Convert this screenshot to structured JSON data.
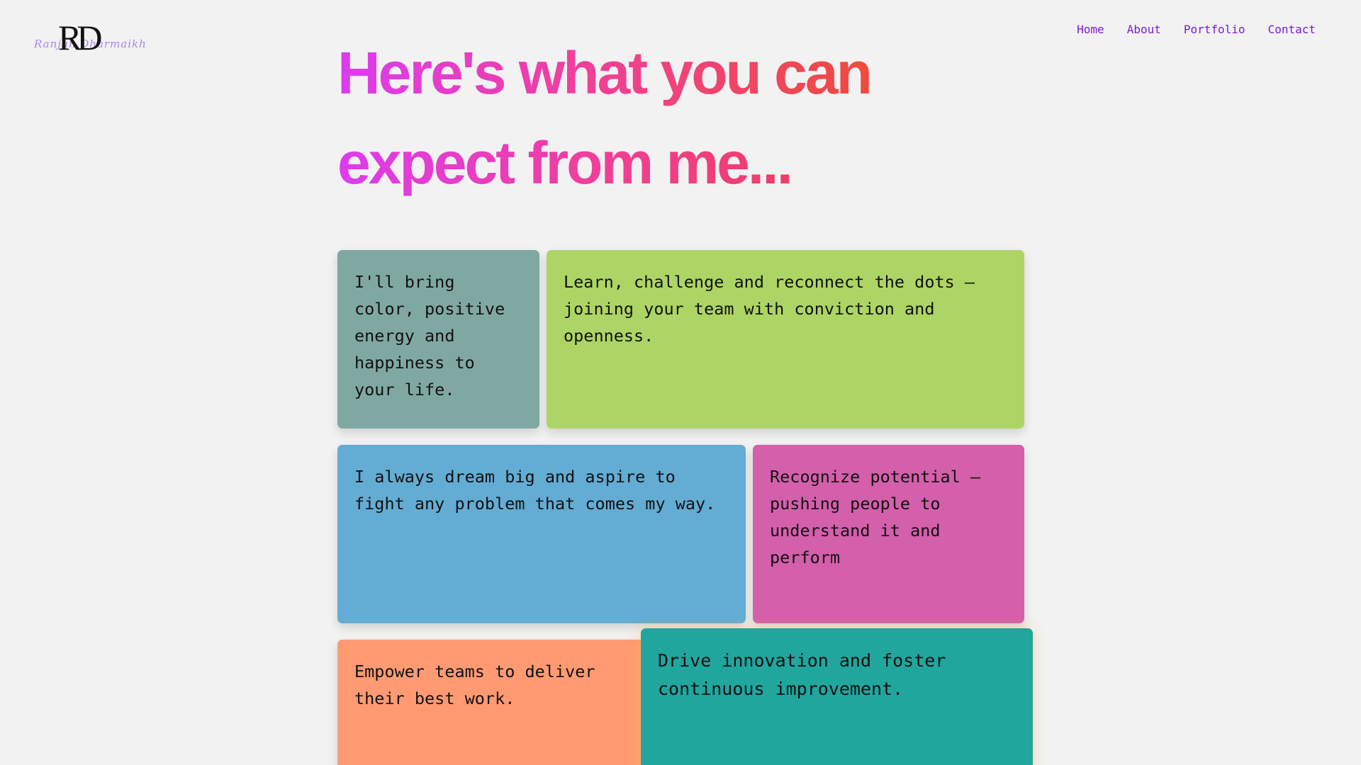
{
  "logo": {
    "mark": "RD",
    "signature": "Ranjan Dharmaikh"
  },
  "nav": {
    "items": [
      {
        "label": "Home"
      },
      {
        "label": "About"
      },
      {
        "label": "Portfolio"
      },
      {
        "label": "Contact"
      }
    ]
  },
  "headline": {
    "line1": "Here's what you can",
    "line2": "expect from me..."
  },
  "cards": [
    {
      "text": "I'll bring color, positive energy and happiness to your life.",
      "color": "#80a8a2"
    },
    {
      "text": "Learn, challenge and reconnect the dots — joining your team with conviction and openness.",
      "color": "#add565"
    },
    {
      "text": "I always dream big and aspire to fight any problem that comes my way.",
      "color": "#63acd3"
    },
    {
      "text": "Recognize potential — pushing people to understand it and perform",
      "color": "#d45fab"
    },
    {
      "text": "Empower teams to deliver their best work.",
      "color": "#ff9a72"
    },
    {
      "text": "Drive innovation and foster continuous improvement.",
      "color": "#21a69e"
    }
  ],
  "colors": {
    "background": "#f2f2f2",
    "nav_link": "#7a1bd6",
    "headline_gradient": [
      "#dc3cf0",
      "#f03f9c",
      "#f04a3c"
    ]
  }
}
